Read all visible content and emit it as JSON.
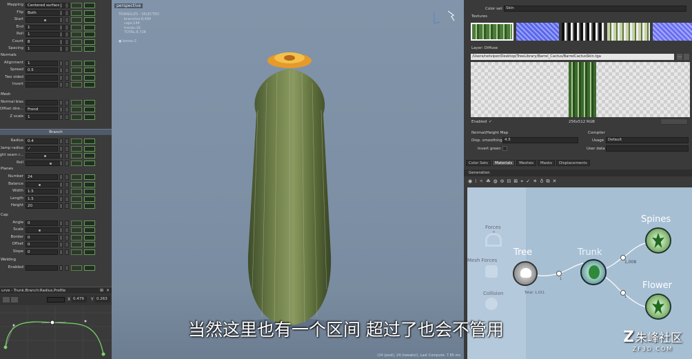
{
  "left_panel": {
    "rows_top": [
      {
        "label": "Mapping",
        "value": "Centered surface"
      },
      {
        "label": "Flip",
        "value": "Both"
      },
      {
        "label": "Start",
        "value": ""
      },
      {
        "label": "End",
        "value": "1"
      },
      {
        "label": "Roll",
        "value": "1"
      },
      {
        "label": "Count",
        "value": "8"
      },
      {
        "label": "Spacing",
        "value": "1"
      }
    ],
    "normals_header": "Normals",
    "normals_rows": [
      {
        "label": "Alignment",
        "value": "1"
      },
      {
        "label": "Spread",
        "value": "0.5"
      },
      {
        "label": "Two sided",
        "value": ""
      },
      {
        "label": "Invert",
        "value": ""
      }
    ],
    "mesh_header": "Mesh",
    "mesh_rows": [
      {
        "label": "Normal bias",
        "value": ""
      },
      {
        "label": "Offset dire...",
        "value": "Frond"
      },
      {
        "label": "Z scale",
        "value": "1"
      }
    ],
    "branch_bar": "Branch",
    "branch_rows": [
      {
        "label": "Radius",
        "value": "0.4"
      },
      {
        "label": "Clamp radius",
        "value": "✓"
      },
      {
        "label": "ght seam r...",
        "value": ""
      },
      {
        "label": "Roll",
        "value": ""
      }
    ],
    "planes_header": "Planes",
    "planes_rows": [
      {
        "label": "Number",
        "value": "24"
      },
      {
        "label": "Balance",
        "value": ""
      },
      {
        "label": "Width",
        "value": "1.5"
      },
      {
        "label": "Length",
        "value": "1.5"
      },
      {
        "label": "Height",
        "value": "20"
      }
    ],
    "cap_header": "Cap",
    "cap_rows": [
      {
        "label": "Angle",
        "value": "0"
      },
      {
        "label": "Scale",
        "value": ""
      },
      {
        "label": "Border",
        "value": "0"
      },
      {
        "label": "Offset",
        "value": "0"
      },
      {
        "label": "Slope",
        "value": "0"
      }
    ],
    "welding_header": "Welding",
    "welding_rows": [
      {
        "label": "Enabled",
        "value": ""
      }
    ],
    "curve_title": "urve - Trunk.Branch:Radius.Profile",
    "curve_x": "0.479",
    "curve_y": "0.263",
    "curve_x_label": "X",
    "curve_y_label": "Y"
  },
  "viewport": {
    "label": "perspective",
    "stats": [
      "TRIANGLES - SELECTED",
      "branches:8,490",
      "caps:144",
      "fronds:16",
      "TOTAL:8,728",
      "",
      "● bones:2"
    ],
    "status": "(24 (post), 24 (tweaks)), Last Compute: 7.65 ms"
  },
  "right_panel": {
    "color_set_label": "Color set",
    "color_set_value": "Skin",
    "textures_label": "Textures",
    "layer_label": "Layer: Diffuse",
    "path": "/Users/netviper/Desktop/TreeLibrary/Barrel_Cactus/BarrelCactusSkin.tga",
    "enabled_label": "Enabled",
    "enabled_value": "✓",
    "resolution": "256x512  RGB",
    "normal_header": "Normal/Height Map",
    "disp_label": "Disp. smoothing",
    "disp_value": "4.5",
    "invert_label": "Invert green",
    "compiler_header": "Compiler",
    "usage_label": "Usage",
    "usage_value": "Default",
    "userdata_label": "User data",
    "tabs": [
      "Color Sets",
      "Materials",
      "Meshes",
      "Masks",
      "Displacements"
    ],
    "generation_label": "Generation",
    "graph": {
      "forces": "Forces",
      "forces_count": "0",
      "mesh_forces": "Mesh Forces",
      "collision": "Collision",
      "tree": "Tree",
      "tree_total": "Total: 1,011",
      "edge1": "1",
      "trunk": "Trunk",
      "edge2": "1,008",
      "edge3": "1",
      "spines": "Spines",
      "flower": "Flower"
    }
  },
  "subtitle": "当然这里也有一个区间 超过了也会不管用",
  "watermark": {
    "brand": "朱峰社区",
    "url": "ZF3D.COM"
  },
  "colors": {
    "accent_blue": "#4f5a6a",
    "green_node": "#4a8a2a",
    "panel": "#3b3b3b"
  }
}
